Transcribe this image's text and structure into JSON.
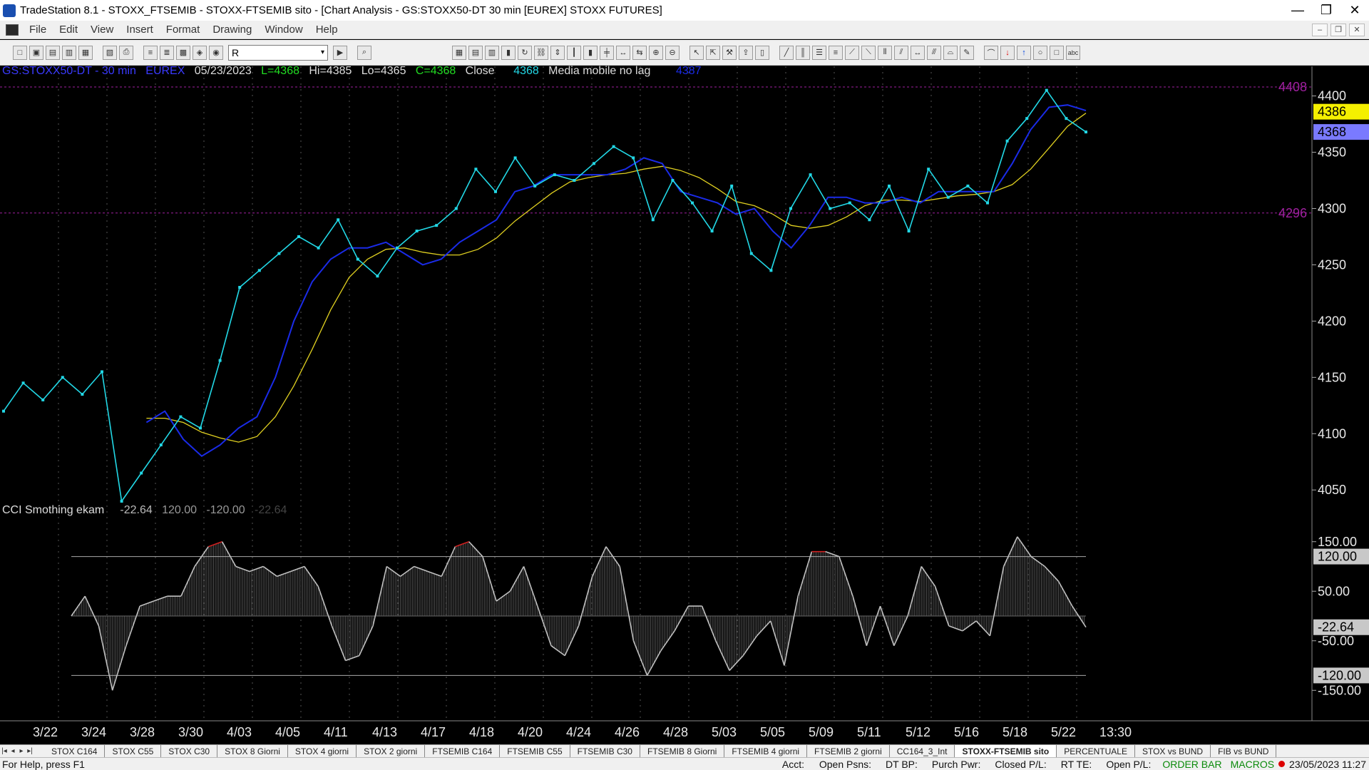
{
  "window": {
    "title": "TradeStation 8.1 - STOXX_FTSEMIB - STOXX-FTSEMIB sito - [Chart Analysis - GS:STOXX50-DT  30 min  [EUREX] STOXX FUTURES]",
    "minimize": "—",
    "maximize": "❐",
    "close": "✕"
  },
  "menu": {
    "items": [
      "File",
      "Edit",
      "View",
      "Insert",
      "Format",
      "Drawing",
      "Window",
      "Help"
    ],
    "mdi_buttons": [
      "–",
      "❐",
      "✕"
    ]
  },
  "toolbar": {
    "symbol_value": "R",
    "dropdown_icon": "▾",
    "go_icon": "▶"
  },
  "price_legend": {
    "symbol": "GS:STOXX50-DT - 30 min",
    "exchange": "EUREX",
    "date": "05/23/2023",
    "last": "L=4368",
    "high": "Hi=4385",
    "low": "Lo=4365",
    "close": "C=4368",
    "close_label": "Close",
    "close_value": "4368",
    "indicator_name": "Media mobile no lag",
    "indicator_value": "4387"
  },
  "cci_legend": {
    "name": "CCI Smothing ekam",
    "v1": "-22.64",
    "v2": "120.00",
    "v3": "-120.00",
    "v4": "-22.64"
  },
  "colors": {
    "price": "#22d8e6",
    "ma_fast": "#1a2be8",
    "ma_slow": "#e0d020",
    "level_line": "#a020a0",
    "cci_line": "#c0c0c0",
    "cci_high": "#d02020",
    "cci_low": "#22c0d0",
    "green_text": "#22dd22",
    "blue_text": "#3030ff"
  },
  "price_axis": {
    "ticks": [
      "4400",
      "4350",
      "4300",
      "4250",
      "4200",
      "4150",
      "4100",
      "4050"
    ],
    "level_high": "4408",
    "level_low": "4296",
    "marker_ma": "4386",
    "marker_last": "4368"
  },
  "cci_axis": {
    "ticks": [
      "150.00",
      "50.00",
      "-50.00",
      "-150.00"
    ],
    "marker_upper": "120.00",
    "marker_value": "-22.64",
    "marker_lower": "-120.00"
  },
  "time_axis": {
    "labels": [
      "3/22",
      "3/24",
      "3/28",
      "3/30",
      "4/03",
      "4/05",
      "4/11",
      "4/13",
      "4/17",
      "4/18",
      "4/20",
      "4/24",
      "4/26",
      "4/28",
      "5/03",
      "5/05",
      "5/09",
      "5/11",
      "5/12",
      "5/16",
      "5/18",
      "5/22",
      "13:30"
    ]
  },
  "chart_data": {
    "type": "line",
    "title": "GS:STOXX50-DT - 30 min",
    "ylim": [
      4040,
      4420
    ],
    "levels": [
      4408,
      4296
    ],
    "series": [
      {
        "name": "Close",
        "values": [
          4120,
          4145,
          4130,
          4150,
          4135,
          4155,
          4040,
          4065,
          4090,
          4115,
          4105,
          4165,
          4230,
          4245,
          4260,
          4275,
          4265,
          4290,
          4255,
          4240,
          4265,
          4280,
          4285,
          4300,
          4335,
          4315,
          4345,
          4320,
          4330,
          4325,
          4340,
          4355,
          4345,
          4290,
          4325,
          4305,
          4280,
          4320,
          4260,
          4245,
          4300,
          4330,
          4300,
          4305,
          4290,
          4320,
          4280,
          4335,
          4310,
          4320,
          4305,
          4360,
          4380,
          4405,
          4380,
          4368
        ]
      },
      {
        "name": "Media mobile no lag",
        "values": [
          4110,
          4120,
          4110,
          4115,
          4110,
          4120,
          4095,
          4080,
          4090,
          4105,
          4115,
          4150,
          4200,
          4235,
          4255,
          4265,
          4265,
          4270,
          4260,
          4250,
          4255,
          4270,
          4280,
          4290,
          4315,
          4320,
          4330,
          4330,
          4330,
          4330,
          4335,
          4345,
          4340,
          4315,
          4310,
          4305,
          4295,
          4300,
          4280,
          4265,
          4285,
          4310,
          4310,
          4305,
          4305,
          4310,
          4305,
          4315,
          4315,
          4315,
          4315,
          4340,
          4370,
          4390,
          4392,
          4387
        ]
      }
    ],
    "cci": {
      "name": "CCI Smothing ekam",
      "ylim": [
        -200,
        200
      ],
      "thresholds": [
        120,
        -120
      ],
      "values": [
        0,
        40,
        -20,
        -150,
        -60,
        20,
        30,
        40,
        40,
        100,
        140,
        150,
        100,
        90,
        100,
        80,
        90,
        100,
        60,
        -20,
        -90,
        -80,
        -20,
        100,
        80,
        100,
        90,
        80,
        140,
        150,
        120,
        30,
        50,
        100,
        20,
        -60,
        -80,
        -20,
        80,
        140,
        100,
        -50,
        -120,
        -70,
        -30,
        20,
        20,
        -50,
        -110,
        -80,
        -40,
        -10,
        -100,
        40,
        130,
        130,
        120,
        40,
        -60,
        20,
        -60,
        0,
        100,
        60,
        -20,
        -30,
        -10,
        -40,
        100,
        160,
        120,
        100,
        70,
        20,
        -22.64
      ]
    }
  },
  "tabs": {
    "nav": [
      "|◂",
      "◂",
      "▸",
      "▸|"
    ],
    "items": [
      "STOX C164",
      "STOX C55",
      "STOX C30",
      "STOX 8 Giorni",
      "STOX 4 giorni",
      "STOX 2 giorni",
      "FTSEMIB C164",
      "FTSEMIB C55",
      "FTSEMIB C30",
      "FTSEMIB 8 Giorni",
      "FTSEMIB 4 giorni",
      "FTSEMIB 2 giorni",
      "CC164_3_Int",
      "STOXX-FTSEMIB sito",
      "PERCENTUALE",
      "STOX vs BUND",
      "FIB vs BUND"
    ],
    "active": "STOXX-FTSEMIB sito"
  },
  "status": {
    "help": "For Help, press F1",
    "fields": [
      "Acct:",
      "Open Psns:",
      "DT BP:",
      "Purch Pwr:",
      "Closed P/L:",
      "RT TE:",
      "Open P/L:"
    ],
    "order_bar": "ORDER BAR",
    "macros": "MACROS",
    "datetime": "23/05/2023 11:27"
  }
}
